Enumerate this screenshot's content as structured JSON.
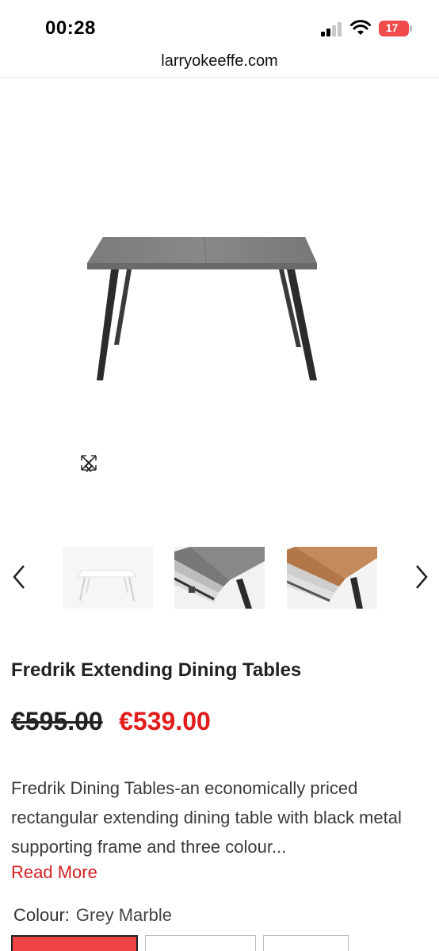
{
  "status_bar": {
    "time": "00:28",
    "battery": "17"
  },
  "browser": {
    "url": "larryokeeffe.com"
  },
  "gallery": {
    "image_count_thumbnails": 3
  },
  "product": {
    "title": "Fredrik Extending Dining Tables",
    "old_price": "€595.00",
    "new_price": "€539.00",
    "description": "Fredrik Dining Tables-an economically priced rectangular extending dining table with black metal supporting frame and three colour...",
    "read_more_label": "Read More",
    "colour_label": "Colour:",
    "colour_value": "Grey Marble"
  },
  "colors": {
    "accent": "#e21c1c",
    "selected_swatch": "#ee4444"
  }
}
